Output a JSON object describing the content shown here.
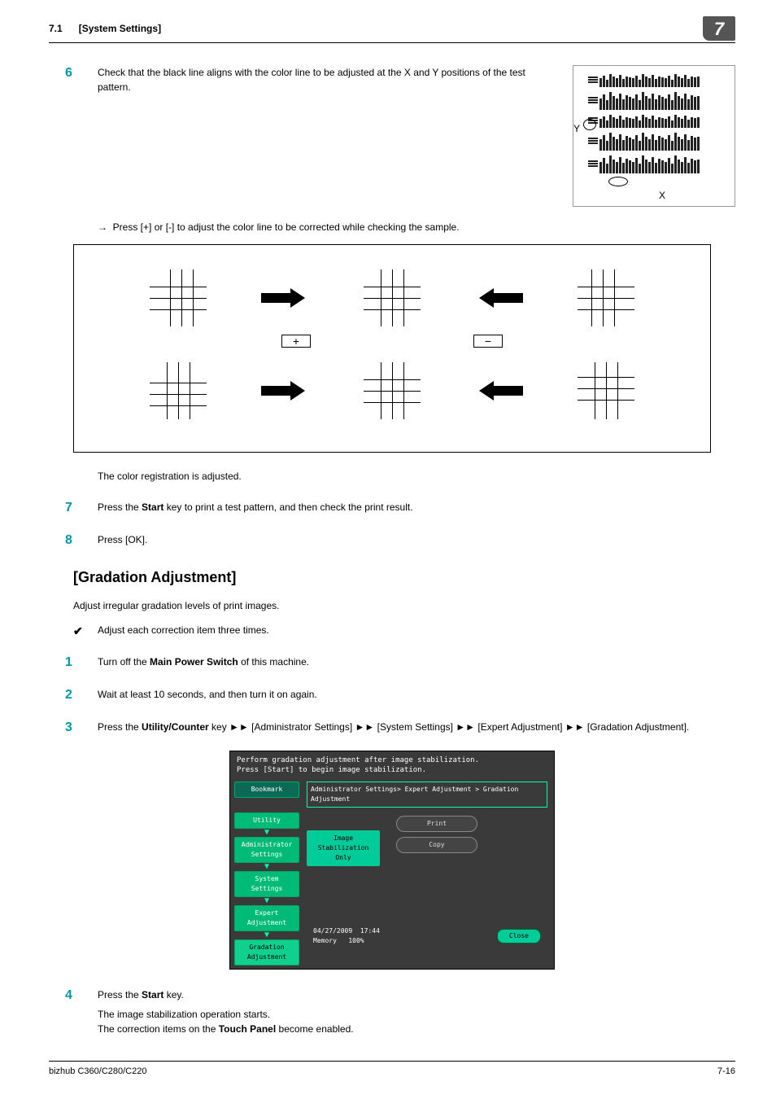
{
  "header": {
    "section": "7.1",
    "title": "[System Settings]",
    "chapter": "7"
  },
  "step6": {
    "num": "6",
    "text": "Check that the black line aligns with the color line to be adjusted at the X and Y positions of the test pattern.",
    "yLabel": "Y",
    "xLabel": "X"
  },
  "arrowLine": {
    "sym": "→",
    "text": "Press [+] or [-] to adjust the color line to be corrected while checking the sample."
  },
  "pm": {
    "plus": "+",
    "minus": "−"
  },
  "afterDiagram": "The color registration is adjusted.",
  "step7": {
    "num": "7",
    "t1": "Press the ",
    "b1": "Start",
    "t2": " key to print a test pattern, and then check the print result."
  },
  "step8": {
    "num": "8",
    "text": "Press [OK]."
  },
  "gradation": {
    "heading": "[Gradation Adjustment]",
    "intro": "Adjust irregular gradation levels of print images.",
    "check": "Adjust each correction item three times."
  },
  "g1": {
    "num": "1",
    "t1": "Turn off the ",
    "b1": "Main Power Switch",
    "t2": " of this machine."
  },
  "g2": {
    "num": "2",
    "text": "Wait at least 10 seconds, and then turn it on again."
  },
  "g3": {
    "num": "3",
    "t1": "Press the ",
    "b1": "Utility/Counter",
    "t2": " key ►► [Administrator Settings] ►► [System Settings] ►► [Expert Adjustment] ►► [Gradation Adjustment]."
  },
  "screenshot": {
    "topLine1": "Perform gradation adjustment after image stabilization.",
    "topLine2": "Press [Start] to begin image stabilization.",
    "bookmark": "Bookmark",
    "crumbs": {
      "c1": "Utility",
      "c2": "Administrator Settings",
      "c3": "System Settings",
      "c4": "Expert Adjustment",
      "c5": "Gradation Adjustment"
    },
    "path": "Administrator Settings> Expert Adjustment > Gradation Adjustment",
    "stabBtn": "Image Stabilization Only",
    "printBtn": "Print",
    "copyBtn": "Copy",
    "date": "04/27/2009",
    "time": "17:44",
    "memLabel": "Memory",
    "memVal": "100%",
    "close": "Close"
  },
  "g4": {
    "num": "4",
    "t1": "Press the ",
    "b1": "Start",
    "t2": " key.",
    "line2": "The image stabilization operation starts.",
    "line3a": "The correction items on the ",
    "line3b": "Touch Panel",
    "line3c": " become enabled."
  },
  "footer": {
    "model": "bizhub C360/C280/C220",
    "page": "7-16"
  }
}
